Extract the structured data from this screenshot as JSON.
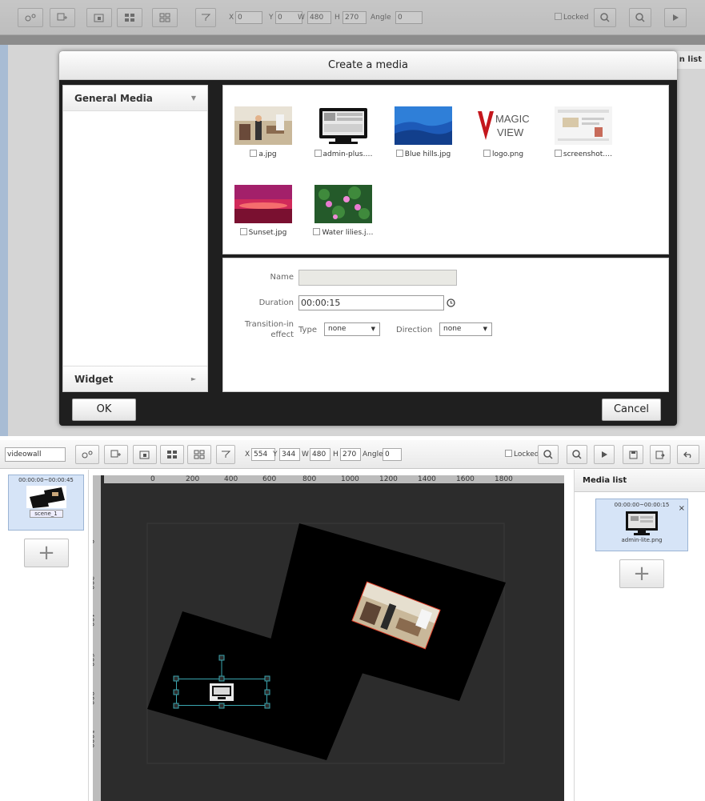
{
  "top_toolbar": {
    "fields": {
      "x": "0",
      "y": "0",
      "w": "480",
      "h": "270",
      "angle": "0"
    },
    "labels": {
      "x": "X",
      "y": "Y",
      "w": "W",
      "h": "H",
      "angle": "Angle"
    },
    "locked_label": "Locked"
  },
  "background_panel": {
    "title_fragment": "n list"
  },
  "dialog": {
    "title": "Create a media",
    "categories": [
      {
        "label": "General Media",
        "arrow": "▼"
      },
      {
        "label": "Widget",
        "arrow": "►"
      }
    ],
    "media": [
      {
        "label": "a.jpg",
        "thumb": "office-photo"
      },
      {
        "label": "admin-plus.…",
        "thumb": "monitor-screenshot"
      },
      {
        "label": "Blue hills.jpg",
        "thumb": "blue-hills"
      },
      {
        "label": "logo.png",
        "thumb": "magic-view-logo"
      },
      {
        "label": "screenshot.…",
        "thumb": "screenshot-page"
      },
      {
        "label": "Sunset.jpg",
        "thumb": "sunset"
      },
      {
        "label": "Water lilies.j…",
        "thumb": "water-lilies"
      }
    ],
    "logo_text": {
      "line1": "MAGIC",
      "line2": "VIEW"
    },
    "form": {
      "name_label": "Name",
      "name_value": "",
      "duration_label": "Duration",
      "duration_value": "00:00:15",
      "transition_label_1": "Transition-in",
      "transition_label_2": "effect",
      "type_label": "Type",
      "type_value": "none",
      "direction_label": "Direction",
      "direction_value": "none"
    },
    "ok_label": "OK",
    "cancel_label": "Cancel"
  },
  "editor": {
    "project_input": "videowall",
    "fields": {
      "x": "554",
      "y": "344",
      "w": "480",
      "h": "270",
      "angle": "0"
    },
    "labels": {
      "x": "X",
      "y": "Y",
      "w": "W",
      "h": "H",
      "angle": "Angle"
    },
    "locked_label": "Locked",
    "scene": {
      "time": "00:00:00~00:00:45",
      "name": "scene_1"
    },
    "add_symbol": "+",
    "ruler_h": [
      "0",
      "200",
      "400",
      "600",
      "800",
      "1000",
      "1200",
      "1400",
      "1600",
      "1800"
    ],
    "ruler_v": [
      "0",
      "200",
      "400",
      "600",
      "800",
      "1000"
    ],
    "media_list": {
      "title": "Media list",
      "item": {
        "time": "00:00:00~00:00:15",
        "name": "admin-lite.png",
        "remove": "×"
      }
    }
  },
  "colors": {
    "selection": "#3aa6b0",
    "accent_blue": "#d6e4f7",
    "canvas": "#2c2c2c"
  }
}
